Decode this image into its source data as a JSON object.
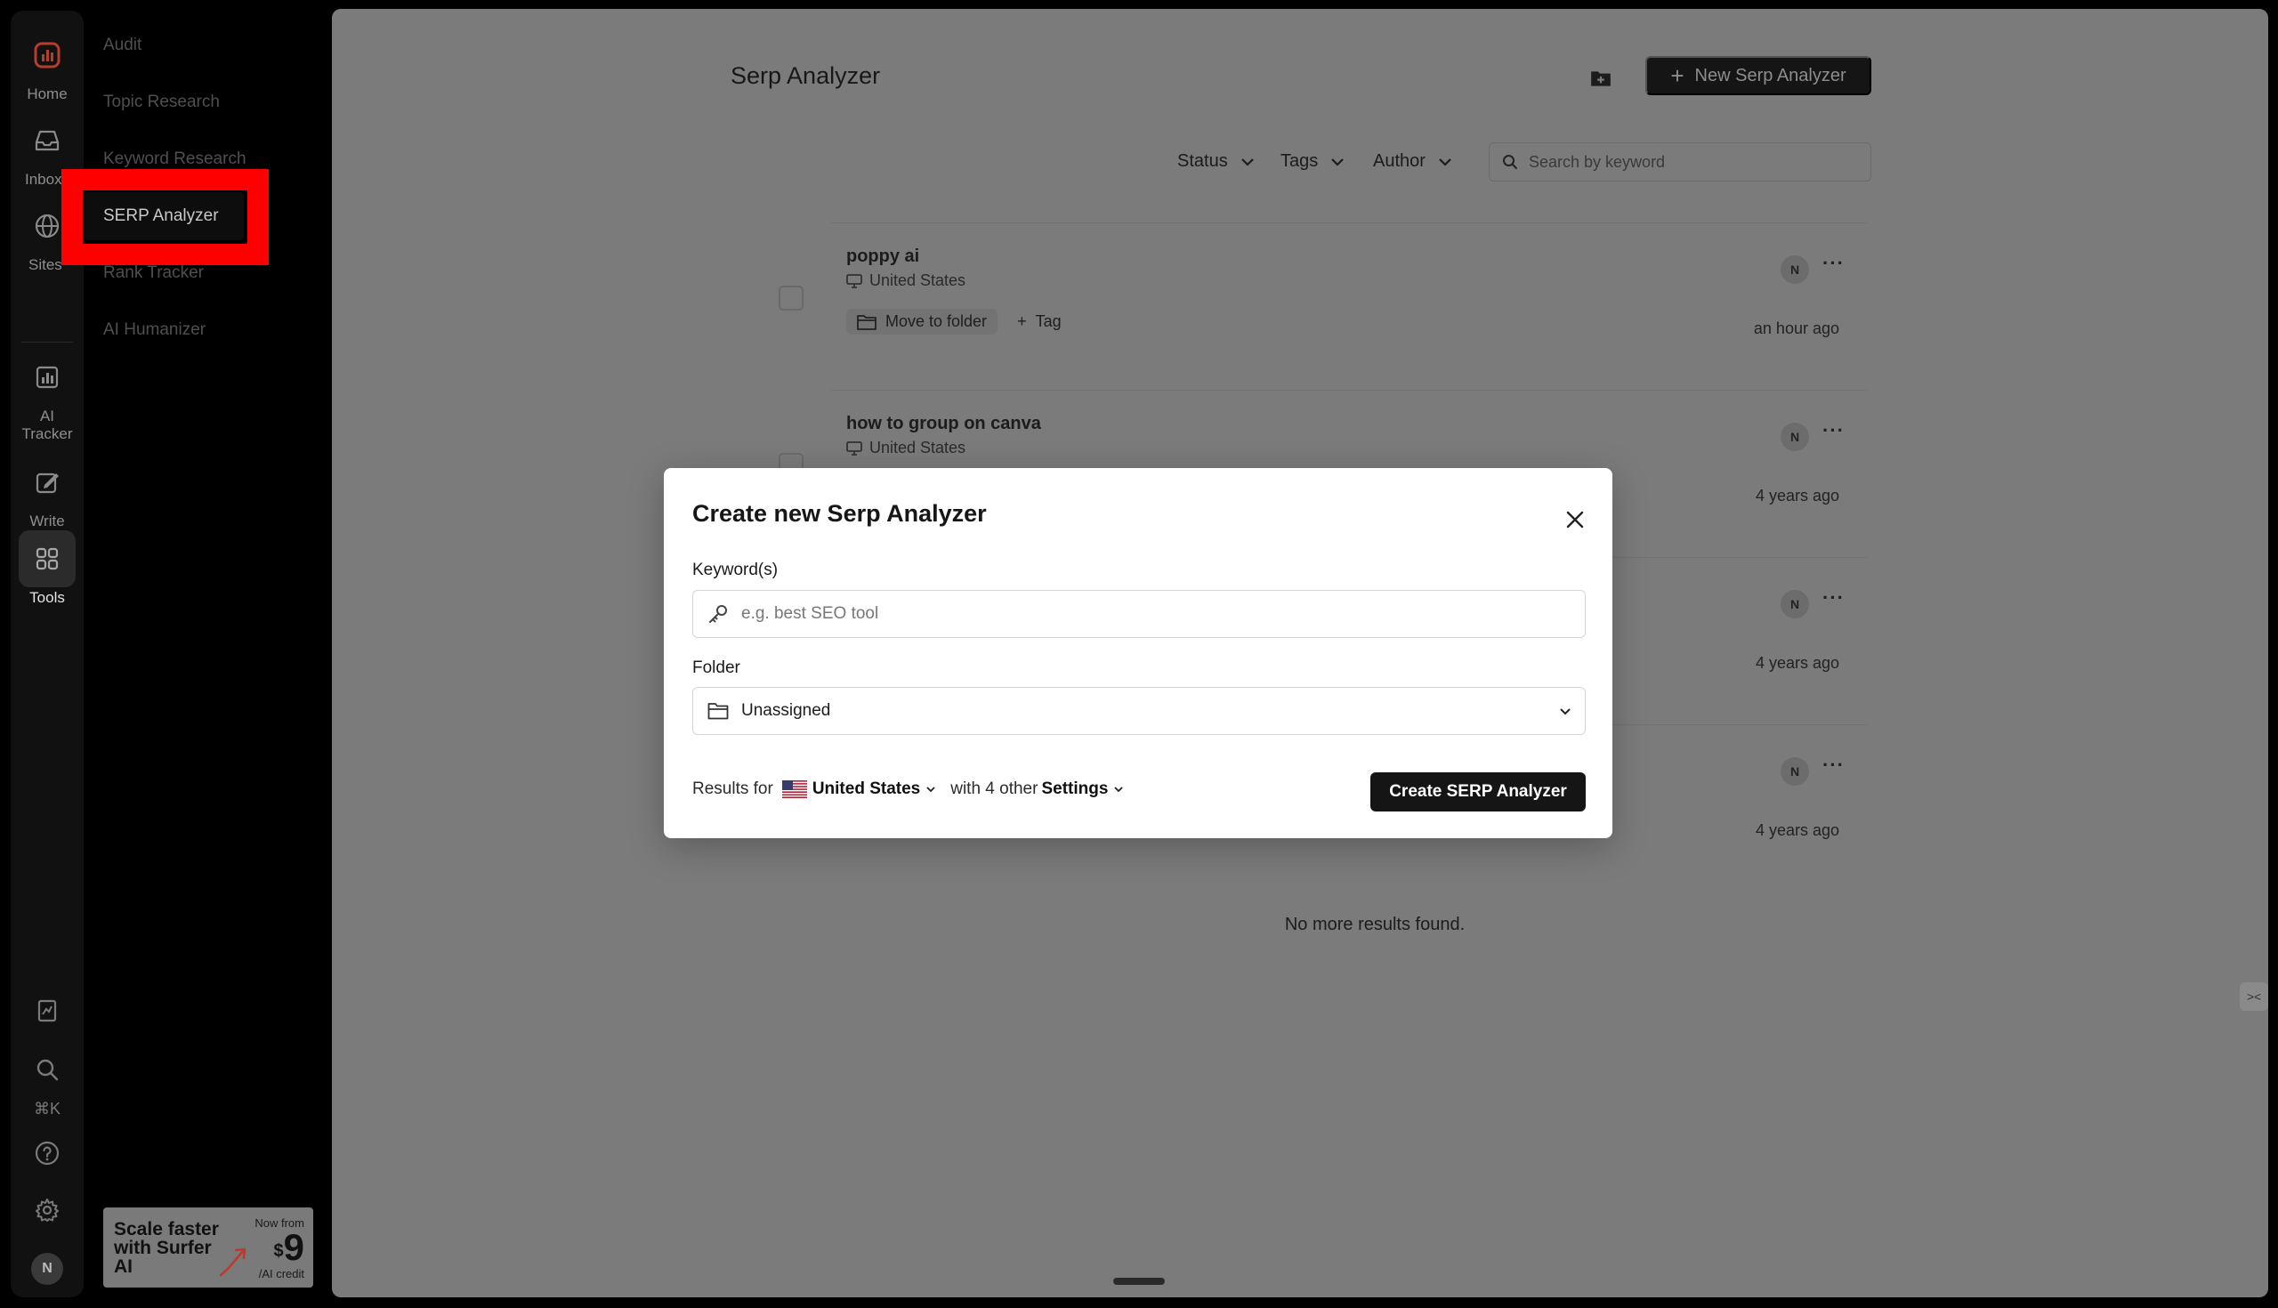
{
  "rail": {
    "items": [
      {
        "label": "Home",
        "icon": "chart-logo-icon"
      },
      {
        "label": "Inbox",
        "icon": "inbox-icon"
      },
      {
        "label": "Sites",
        "icon": "globe-icon"
      },
      {
        "label": "AI\nTracker",
        "icon": "ai-tracker-icon"
      },
      {
        "label": "Write",
        "icon": "write-icon"
      },
      {
        "label": "Tools",
        "icon": "grid-icon"
      }
    ],
    "search_shortcut": "⌘K",
    "avatar_initial": "N"
  },
  "subnav": {
    "items": [
      "Audit",
      "Topic Research",
      "Keyword Research",
      "SERP Analyzer",
      "Rank Tracker",
      "AI Humanizer"
    ],
    "active": "SERP Analyzer"
  },
  "promo": {
    "headline": "Scale faster with Surfer AI",
    "now_from": "Now from",
    "currency": "$",
    "price": "9",
    "unit": "/AI credit"
  },
  "page": {
    "title": "Serp Analyzer",
    "new_button": "New Serp Analyzer",
    "filters": {
      "status": "Status",
      "tags": "Tags",
      "author": "Author"
    },
    "search_placeholder": "Search by keyword",
    "no_more": "No more results found."
  },
  "rows": [
    {
      "keyword": "poppy ai",
      "location": "United States",
      "author": "N",
      "time": "an hour ago",
      "move": "Move to folder",
      "tag": "Tag"
    },
    {
      "keyword": "how to group on canva",
      "location": "United States",
      "author": "N",
      "time": "4 years ago"
    },
    {
      "author": "N",
      "time": "4 years ago"
    },
    {
      "author": "N",
      "time": "4 years ago"
    }
  ],
  "modal": {
    "title": "Create new Serp Analyzer",
    "keyword_label": "Keyword(s)",
    "keyword_placeholder": "e.g. best SEO tool",
    "folder_label": "Folder",
    "folder_value": "Unassigned",
    "results_for": "Results for",
    "country": "United States",
    "with_other": "with 4 other",
    "settings": "Settings",
    "create_button": "Create SERP Analyzer"
  },
  "colors": {
    "highlight": "#ff0000",
    "primary_button": "#151515",
    "overlay": "#7b7b7b"
  }
}
